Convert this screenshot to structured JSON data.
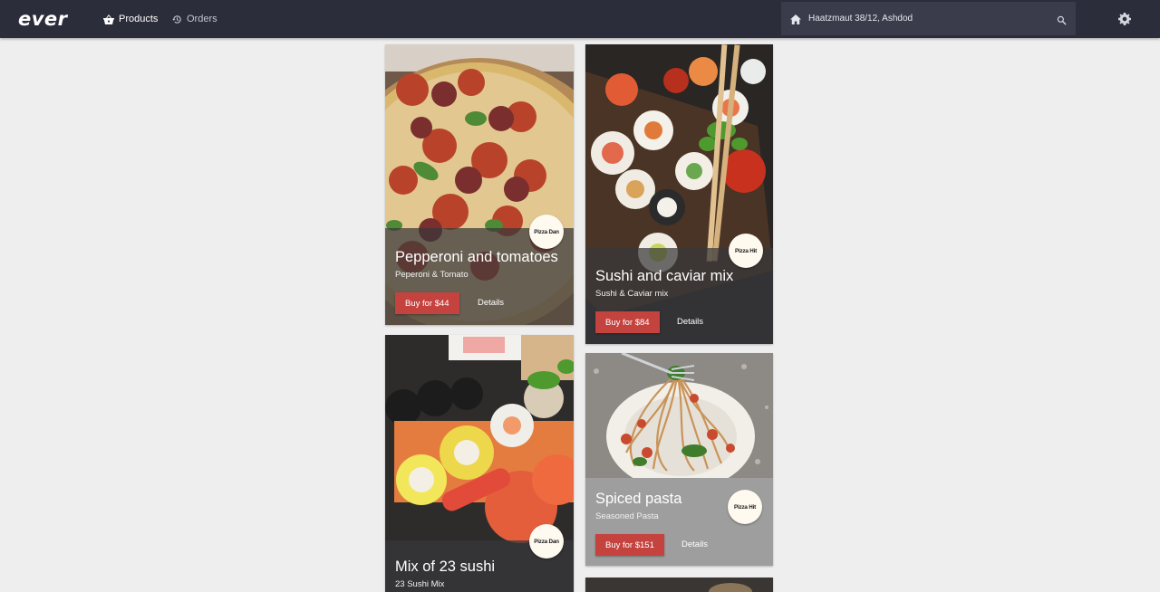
{
  "brand": {
    "logo_text": "ever"
  },
  "nav": {
    "products": {
      "label": "Products",
      "icon": "basket-icon"
    },
    "orders": {
      "label": "Orders",
      "icon": "history-icon"
    }
  },
  "search": {
    "value": "Haatzmaut 38/12, Ashdod",
    "leading_icon": "home-icon",
    "trailing_icon": "search-icon"
  },
  "settings": {
    "icon": "gear-icon"
  },
  "colors": {
    "topbar": "#2c2d3a",
    "search_bg": "#3a3b4b",
    "page_bg": "#eeeeee",
    "buy_button": "#c5433f",
    "card_overlay": "#37373a"
  },
  "products": [
    {
      "title": "Pepperoni and tomatoes",
      "subtitle": "Peperoni & Tomato",
      "buy_label": "Buy for $44",
      "details_label": "Details",
      "merchant": "Pizza Dan"
    },
    {
      "title": "Sushi and caviar mix",
      "subtitle": "Sushi & Caviar mix",
      "buy_label": "Buy for $84",
      "details_label": "Details",
      "merchant": "Pizza Hit"
    },
    {
      "title": "Mix of 23 sushi",
      "subtitle": "23 Sushi Mix",
      "buy_label": "",
      "details_label": "",
      "merchant": "Pizza Dan"
    },
    {
      "title": "Spiced pasta",
      "subtitle": "Seasoned Pasta",
      "buy_label": "Buy for $151",
      "details_label": "Details",
      "merchant": "Pizza Hit"
    }
  ]
}
